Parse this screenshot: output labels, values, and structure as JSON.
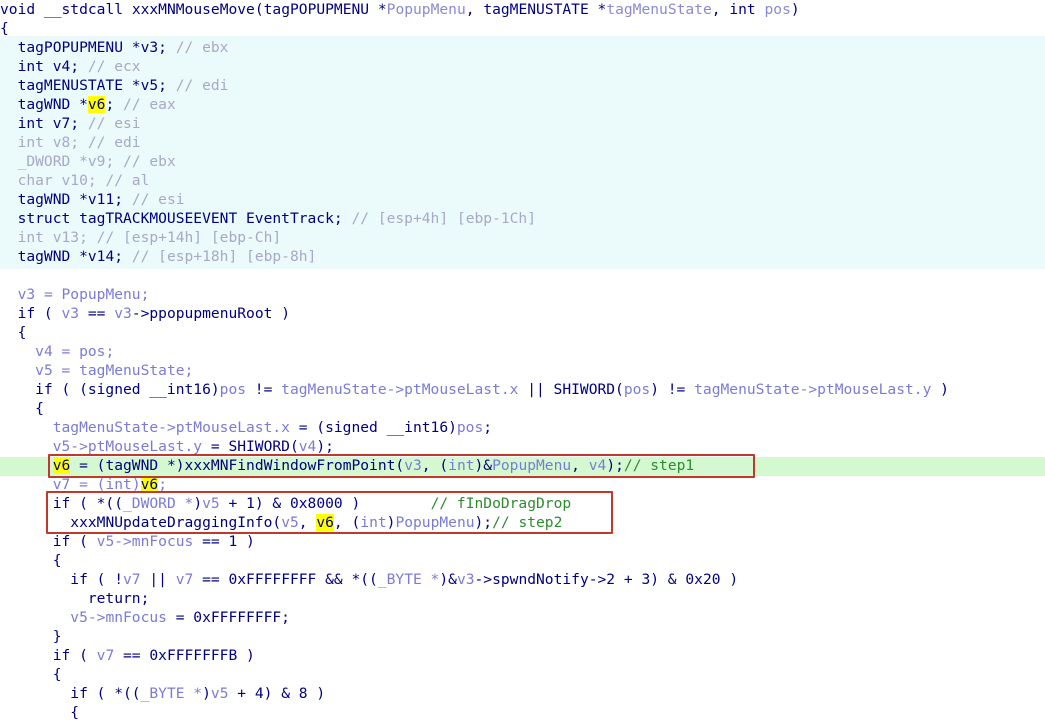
{
  "app": {
    "view_name": "pseudocode-decompiler-view",
    "colors": {
      "background": "#ffffff",
      "declaration_block": "#ebfafa",
      "current_line": "#d4f8d0",
      "highlight_identifier": "#ffff00",
      "annotation_box": "#c0392b",
      "comment": "#2e8b2e",
      "keyword": "#000080",
      "local_variable": "#7b7bd6",
      "greyed_text": "#a8a8c8"
    },
    "highlighted_identifier": "v6"
  },
  "signature": {
    "return_type": "void",
    "calling_convention": "__stdcall",
    "function_name": "xxxMNMouseMove",
    "params": "(tagPOPUPMENU *PopupMenu, tagMENUSTATE *tagMenuState, int pos)",
    "full_text": "void __stdcall xxxMNMouseMove(tagPOPUPMENU *PopupMenu, tagMENUSTATE *tagMenuState, int pos)"
  },
  "declarations": [
    {
      "text": "tagPOPUPMENU *v3; // ebx",
      "type": "tagPOPUPMENU *",
      "name": "v3",
      "register": "ebx",
      "greyed": false
    },
    {
      "text": "int v4; // ecx",
      "type": "int",
      "name": "v4",
      "register": "ecx",
      "greyed": false
    },
    {
      "text": "tagMENUSTATE *v5; // edi",
      "type": "tagMENUSTATE *",
      "name": "v5",
      "register": "edi",
      "greyed": false
    },
    {
      "text": "tagWND *v6; // eax",
      "type": "tagWND *",
      "name": "v6",
      "register": "eax",
      "greyed": false
    },
    {
      "text": "int v7; // esi",
      "type": "int",
      "name": "v7",
      "register": "esi",
      "greyed": false
    },
    {
      "text": "int v8; // edi",
      "type": "int",
      "name": "v8",
      "register": "edi",
      "greyed": true
    },
    {
      "text": "_DWORD *v9; // ebx",
      "type": "_DWORD *",
      "name": "v9",
      "register": "ebx",
      "greyed": true
    },
    {
      "text": "char v10; // al",
      "type": "char",
      "name": "v10",
      "register": "al",
      "greyed": true
    },
    {
      "text": "tagWND *v11; // esi",
      "type": "tagWND *",
      "name": "v11",
      "register": "esi",
      "greyed": false
    },
    {
      "text": "struct tagTRACKMOUSEEVENT EventTrack; // [esp+4h] [ebp-1Ch]",
      "type": "struct tagTRACKMOUSEEVENT",
      "name": "EventTrack",
      "register": "[esp+4h] [ebp-1Ch]",
      "greyed": false
    },
    {
      "text": "int v13; // [esp+14h] [ebp-Ch]",
      "type": "int",
      "name": "v13",
      "register": "[esp+14h] [ebp-Ch]",
      "greyed": true
    },
    {
      "text": "tagWND *v14; // [esp+18h] [ebp-8h]",
      "type": "tagWND *",
      "name": "v14",
      "register": "[esp+18h] [ebp-8h]",
      "greyed": false
    }
  ],
  "code_lines": [
    "v3 = PopupMenu;",
    "if ( v3 == v3->ppopupmenuRoot )",
    "{",
    "  v4 = pos;",
    "  v5 = tagMenuState;",
    "  if ( (signed __int16)pos != tagMenuState->ptMouseLast.x || SHIWORD(pos) != tagMenuState->ptMouseLast.y )",
    "  {",
    "    tagMenuState->ptMouseLast.x = (signed __int16)pos;",
    "    v5->ptMouseLast.y = SHIWORD(v4);",
    "    v6 = (tagWND *)xxxMNFindWindowFromPoint(v3, (int)&PopupMenu, v4);// step1",
    "    v7 = (int)v6;",
    "    if ( *((_DWORD *)v5 + 1) & 0x8000 )        // fInDoDragDrop",
    "      xxxMNUpdateDraggingInfo(v5, v6, (int)PopupMenu);// step2",
    "    if ( v5->mnFocus == 1 )",
    "    {",
    "      if ( !v7 || v7 == 0xFFFFFFFF && *((_BYTE *)&v3->spwndNotify->2 + 3) & 0x20 )",
    "        return;",
    "      v5->mnFocus = 0xFFFFFFFF;",
    "    }",
    "    if ( v7 == 0xFFFFFFFB )",
    "    {",
    "      if ( *((_BYTE *)v5 + 4) & 8 )",
    "      {"
  ],
  "annotations": [
    {
      "label": "step1",
      "target_line": "v6 = (tagWND *)xxxMNFindWindowFromPoint(v3, (int)&PopupMenu, v4);",
      "comment": "// step1"
    },
    {
      "label": "step2",
      "target_line": "xxxMNUpdateDraggingInfo(v5, v6, (int)PopupMenu);",
      "comment": "// step2"
    },
    {
      "label": "fInDoDragDrop",
      "target_line": "if ( *((_DWORD *)v5 + 1) & 0x8000 )",
      "comment": "// fInDoDragDrop"
    }
  ],
  "current_line_text": "v6 = (tagWND *)xxxMNFindWindowFromPoint(v3, (int)&PopupMenu, v4);// step1",
  "function_names_referenced": [
    "xxxMNMouseMove",
    "xxxMNFindWindowFromPoint",
    "xxxMNUpdateDraggingInfo",
    "SHIWORD"
  ]
}
